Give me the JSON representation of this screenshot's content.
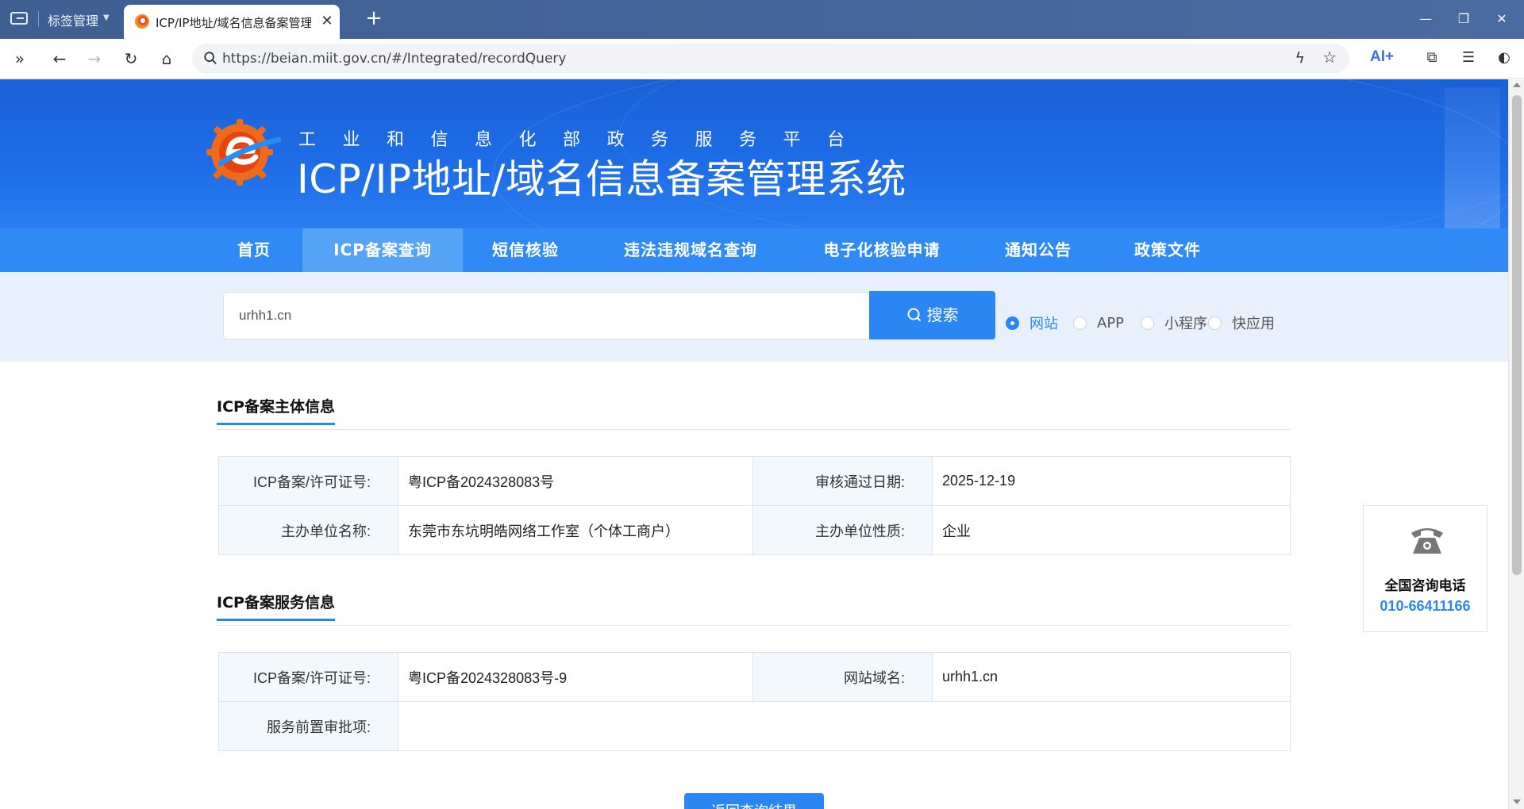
{
  "browser": {
    "group_label": "标签管理",
    "tab_title": "ICP/IP地址/域名信息备案管理系统",
    "url": "https://beian.miit.gov.cn/#/Integrated/recordQuery",
    "ai_label": "AI+",
    "accent": "#3b6ff0"
  },
  "header": {
    "subtitle": "工业和信息化部政务服务平台",
    "title": "ICP/IP地址/域名信息备案管理系统",
    "brand_color": "#1d6ce6"
  },
  "nav": {
    "items": [
      {
        "label": "首页"
      },
      {
        "label": "ICP备案查询"
      },
      {
        "label": "短信核验"
      },
      {
        "label": "违法违规域名查询"
      },
      {
        "label": "电子化核验申请"
      },
      {
        "label": "通知公告"
      },
      {
        "label": "政策文件"
      }
    ],
    "active_index": 1
  },
  "search": {
    "value": "urhh1.cn",
    "button_label": "搜索",
    "options": [
      {
        "label": "网站",
        "checked": true
      },
      {
        "label": "APP",
        "checked": false
      },
      {
        "label": "小程序",
        "checked": false
      },
      {
        "label": "快应用",
        "checked": false
      }
    ]
  },
  "subject_info": {
    "title": "ICP备案主体信息",
    "rows": [
      {
        "k1": "ICP备案/许可证号:",
        "v1": "粤ICP备2024328083号",
        "k2": "审核通过日期:",
        "v2": "2025-12-19"
      },
      {
        "k1": "主办单位名称:",
        "v1": "东莞市东坑明皓网络工作室（个体工商户）",
        "k2": "主办单位性质:",
        "v2": "企业"
      }
    ]
  },
  "service_info": {
    "title": "ICP备案服务信息",
    "license_key": "ICP备案/许可证号:",
    "license_value": "粤ICP备2024328083号-9",
    "domain_key": "网站域名:",
    "domain_value": "urhh1.cn",
    "approval_key": "服务前置审批项:",
    "approval_value": ""
  },
  "return_button": "返回查询结果",
  "hotline": {
    "label": "全国咨询电话",
    "number": "010-66411166"
  }
}
